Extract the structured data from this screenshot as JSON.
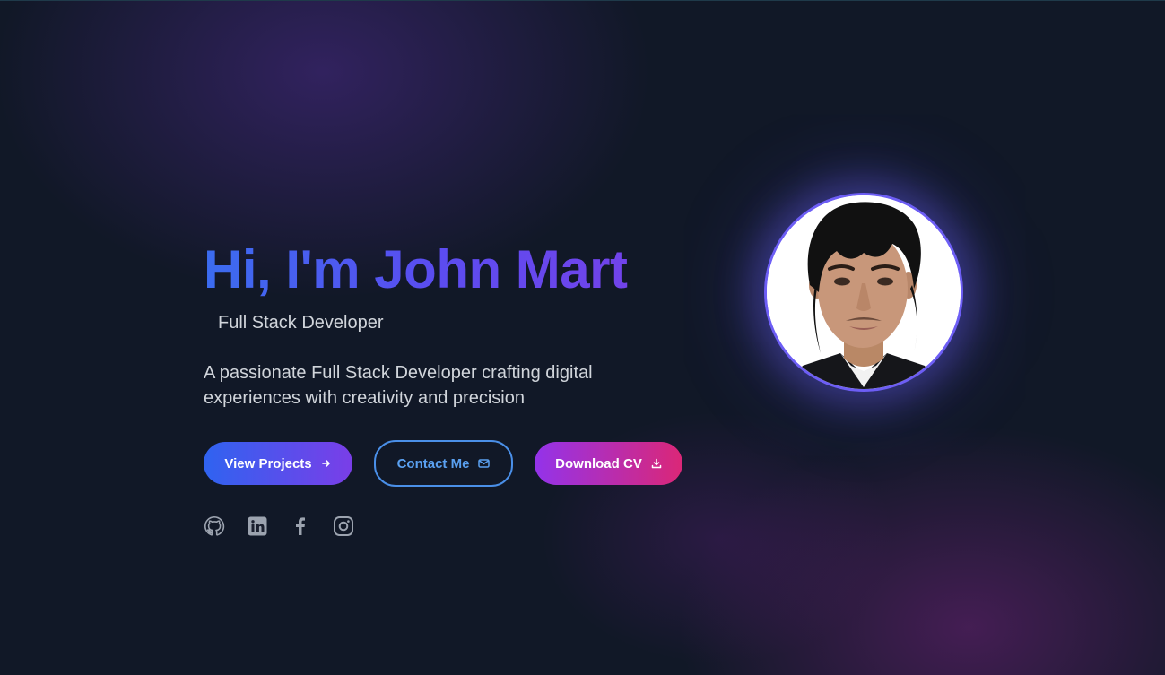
{
  "hero": {
    "greeting": "Hi, I'm John Mart",
    "role": "Full Stack Developer",
    "tagline": "A passionate Full Stack Developer crafting digital experiences with creativity and precision"
  },
  "buttons": {
    "view_projects": "View Projects",
    "contact_me": "Contact Me",
    "download_cv": "Download CV"
  },
  "icons": {
    "view_projects": "arrow-right-icon",
    "contact_me": "mail-icon",
    "download_cv": "download-icon"
  },
  "socials": [
    "github-icon",
    "linkedin-icon",
    "facebook-icon",
    "instagram-icon"
  ],
  "colors": {
    "background": "#111827",
    "gradient_start": "#3b6cf0",
    "gradient_end": "#7b3fe8",
    "outline_blue": "#4a8fe8",
    "cv_start": "#9333ea",
    "cv_end": "#db2777",
    "text_muted": "#d1d5db",
    "icon_gray": "#9ca3af"
  }
}
